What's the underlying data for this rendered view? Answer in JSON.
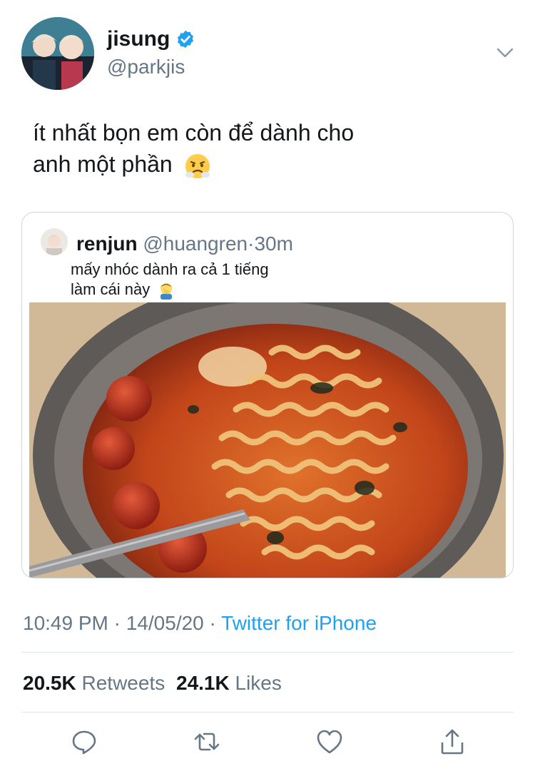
{
  "author": {
    "display_name": "jisung",
    "handle": "@parkjis",
    "verified": true
  },
  "tweet": {
    "text_line1": "ít nhất bọn em còn để dành cho",
    "text_line2": "anh một phần",
    "emoji": "face-with-steam-from-nose"
  },
  "quoted": {
    "name": "renjun",
    "handle": "@huangren",
    "separator": "·",
    "time": "30m",
    "text_line1": "mấy nhóc dành ra cả 1 tiếng",
    "text_line2": "làm cái này",
    "emoji": "person-facepalming",
    "image_subject": "instant ramen with tomatoes in a metal pot"
  },
  "meta": {
    "time": "10:49 PM",
    "separator": "·",
    "date": "14/05/20",
    "source": "Twitter for iPhone"
  },
  "stats": {
    "retweets_count": "20.5K",
    "retweets_label": "Retweets",
    "likes_count": "24.1K",
    "likes_label": "Likes"
  },
  "actions": [
    "reply-icon",
    "retweet-icon",
    "like-icon",
    "share-icon"
  ],
  "colors": {
    "accent": "#1da1f2",
    "secondary_text": "#657786",
    "border": "#ccd6dd"
  }
}
